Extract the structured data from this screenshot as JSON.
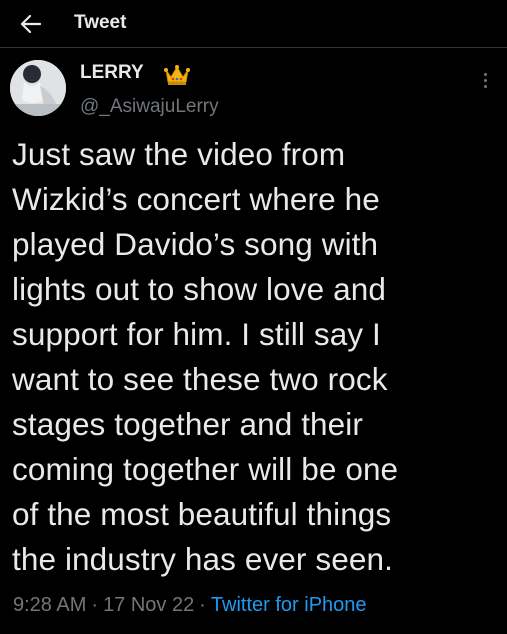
{
  "header": {
    "title": "Tweet",
    "back_icon": "arrow-left-icon"
  },
  "author": {
    "name": "LERRY",
    "name_icon": "crown-icon",
    "handle": "@_AsiwajuLerry"
  },
  "tweet": {
    "lines": [
      "Just saw the video from",
      "Wizkid’s concert where he",
      "played Davido’s song with",
      "lights out to show love and",
      "support for him. I still say I",
      "want to see these two rock",
      "stages together and their",
      "coming together will be one",
      "of the most beautiful things",
      "the industry has ever seen."
    ],
    "time": "9:28 AM",
    "date": "17 Nov 22",
    "source": "Twitter for iPhone",
    "separator": "·"
  },
  "colors": {
    "background": "#000000",
    "text": "#e7e9ea",
    "muted": "#71767b",
    "link": "#1d9bf0",
    "crown": "#f5b50a"
  }
}
